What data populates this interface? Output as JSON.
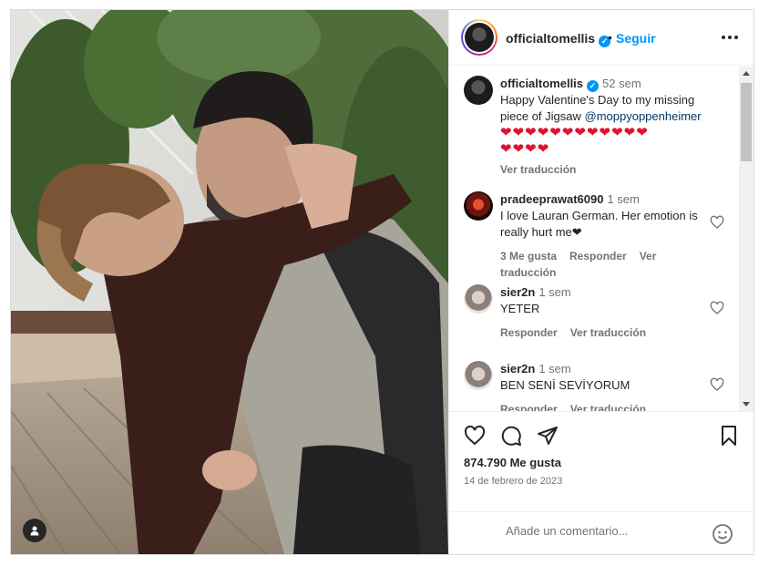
{
  "post": {
    "username": "officialtomellis",
    "follow_label": "Seguir",
    "dot": "•"
  },
  "caption": {
    "username": "officialtomellis",
    "time": "52 sem",
    "text": "Happy Valentine's Day to my missing piece of Jigsaw ",
    "mention": "@moppyoppenheimer",
    "hearts_line1": "❤❤❤❤❤❤❤❤❤❤❤❤",
    "hearts_line2": "❤❤❤❤",
    "translate": "Ver traducción"
  },
  "comments": [
    {
      "username": "pradeeprawat6090",
      "time": "1 sem",
      "text": "I love Lauran German. Her emotion is really hurt me❤",
      "likes": "3 Me gusta",
      "reply": "Responder",
      "translate": "Ver traducción"
    },
    {
      "username": "sier2n",
      "time": "1 sem",
      "text": "YETER",
      "reply": "Responder",
      "translate": "Ver traducción"
    },
    {
      "username": "sier2n",
      "time": "1 sem",
      "text": "BEN SENİ SEVİYORUM",
      "reply": "Responder",
      "translate": "Ver traducción"
    }
  ],
  "likes": "874.790 Me gusta",
  "date": "14 de febrero de 2023",
  "add_comment": {
    "placeholder": "Añade un comentario..."
  },
  "colors": {
    "accent": "#0095f6",
    "heart": "#e0122f",
    "text": "#262626",
    "muted": "#737373"
  },
  "icons": [
    "tag-user-icon",
    "verified-icon",
    "more-icon",
    "heart-icon",
    "comment-icon",
    "share-icon",
    "save-icon",
    "emoji-icon"
  ]
}
